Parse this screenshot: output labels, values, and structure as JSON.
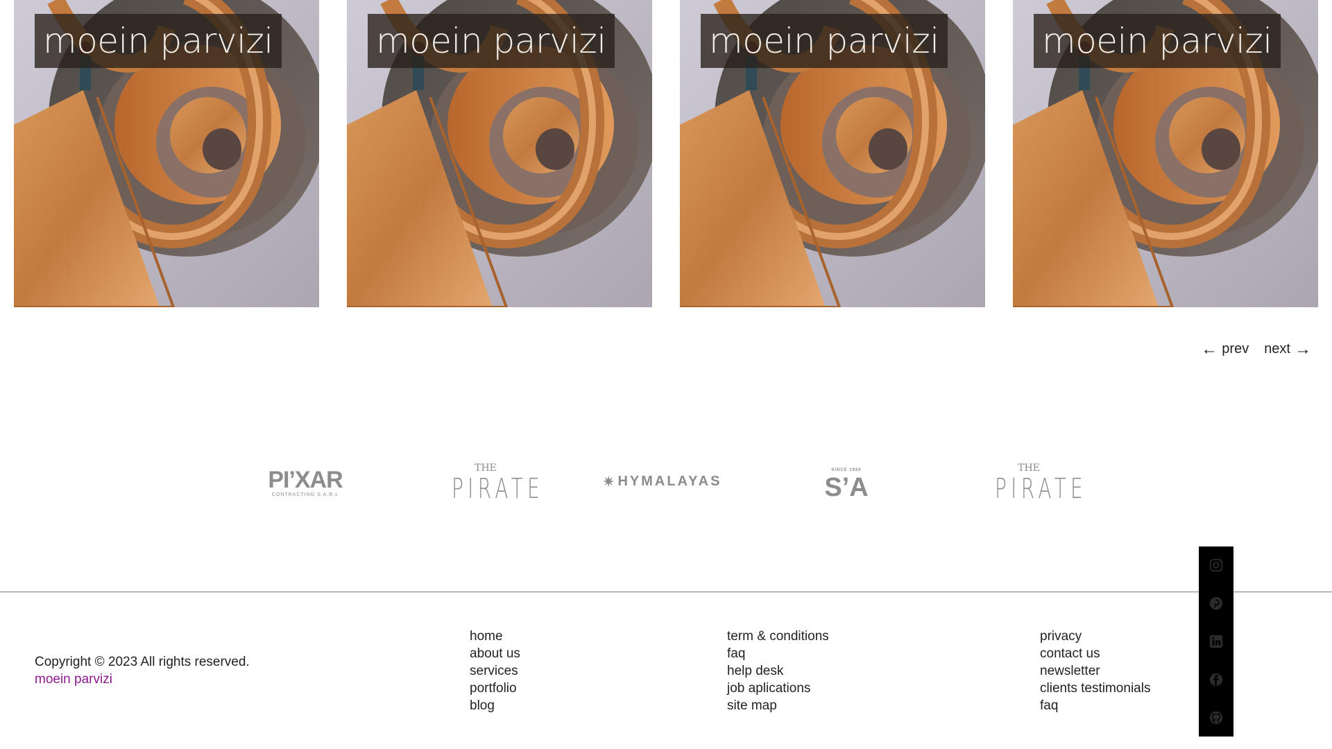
{
  "gallery": {
    "cards": [
      {
        "title": "moein parvizi"
      },
      {
        "title": "moein parvizi"
      },
      {
        "title": "moein parvizi"
      },
      {
        "title": "moein parvizi"
      }
    ]
  },
  "pager": {
    "prev_arrow": "←",
    "prev_label": "prev",
    "next_label": "next",
    "next_arrow": "→"
  },
  "logos": {
    "pixar": {
      "main": "PI’XAR",
      "sub": "CONTRACTING S.A.R.L"
    },
    "pirate": {
      "the": "THE",
      "name": "PIRATE"
    },
    "hymalayas": {
      "star": "✷",
      "name": "HYMALAYAS"
    },
    "sa": {
      "since": "SINCE 1980",
      "mark": "S’A"
    }
  },
  "social": {
    "icons": [
      "instagram-icon",
      "pinterest-icon",
      "linkedin-icon",
      "facebook-icon",
      "github-icon"
    ]
  },
  "footer": {
    "copyright": "Copyright © 2023 All rights reserved.",
    "brand": "moein parvizi",
    "col1": [
      "home",
      "about us",
      "services",
      "portfolio",
      "blog"
    ],
    "col2": [
      "term & conditions",
      "faq",
      "help desk",
      "job aplications",
      "site map"
    ],
    "col3": [
      "privacy",
      "contact us",
      "newsletter",
      "clients testimonials",
      "faq"
    ]
  },
  "colors": {
    "brand_link": "#8b1a8b",
    "title_overlay": "#28201a",
    "social_bar": "#000000"
  }
}
